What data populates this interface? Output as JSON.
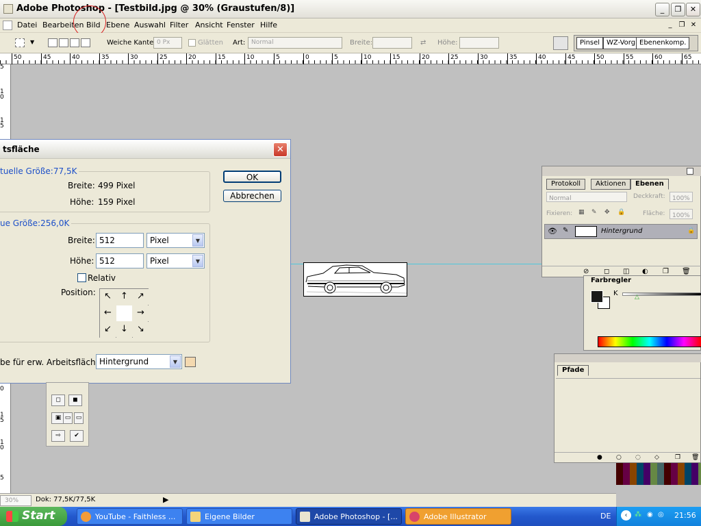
{
  "window": {
    "title": "Adobe Photoshop - [Testbild.jpg @ 30% (Graustufen/8)]",
    "min": "_",
    "max": "❐",
    "close": "✕"
  },
  "menu": [
    "Datei",
    "Bearbeiten",
    "Bild",
    "Ebene",
    "Auswahl",
    "Filter",
    "Ansicht",
    "Fenster",
    "Hilfe"
  ],
  "options": {
    "feather_label": "Weiche Kante:",
    "feather_value": "0 Px",
    "antialias_label": "Glätten",
    "style_label": "Art:",
    "style_value": "Normal",
    "width_label": "Breite:",
    "height_label": "Höhe:",
    "palette_tabs": [
      "Pinsel",
      "WZ-Vorg",
      "Ebenenkomp."
    ]
  },
  "ruler": {
    "h_ticks": [
      "50",
      "45",
      "40",
      "35",
      "30",
      "25",
      "20",
      "15",
      "10",
      "5",
      "0",
      "5",
      "10",
      "15",
      "20",
      "25",
      "30",
      "35",
      "40",
      "45",
      "50",
      "55",
      "60",
      "65"
    ],
    "v_ticks": [
      "5",
      "1\n0",
      "1\n5",
      "0",
      "1\n5",
      "1\n0",
      "5"
    ]
  },
  "dialog": {
    "title": "tsfläche",
    "current_label": "tuelle Größe:77,5K",
    "current_width_label": "Breite:",
    "current_width_value": "499 Pixel",
    "current_height_label": "Höhe:",
    "current_height_value": "159 Pixel",
    "new_label": "ue Größe:256,0K",
    "width_label": "Breite:",
    "width_value": "512",
    "width_unit": "Pixel",
    "height_label": "Höhe:",
    "height_value": "512",
    "height_unit": "Pixel",
    "relative_label": "Relativ",
    "position_label": "Position:",
    "extension_label": "be für erw. Arbeitsfläche:",
    "extension_value": "Hintergrund",
    "ok": "OK",
    "cancel": "Abbrechen",
    "close": "✕"
  },
  "status": {
    "zoom": "30%",
    "doc": "Dok: 77,5K/77,5K"
  },
  "layers_panel": {
    "tabs": [
      "Protokoll",
      "Aktionen",
      "Ebenen"
    ],
    "blend": "Normal",
    "opacity_label": "Deckkraft:",
    "opacity_value": "100%",
    "lock_label": "Fixieren:",
    "fill_label": "Fläche:",
    "fill_value": "100%",
    "layer_name": "Hintergrund"
  },
  "color_panel": {
    "title": "Farbregler",
    "channel": "K"
  },
  "paths_panel": {
    "title": "Pfade"
  },
  "taskbar": {
    "start": "Start",
    "tasks": [
      "YouTube - Faithless ...",
      "Eigene Bilder",
      "Adobe Photoshop - [...",
      "Adobe Illustrator"
    ],
    "lang": "DE",
    "clock": "21:56"
  }
}
